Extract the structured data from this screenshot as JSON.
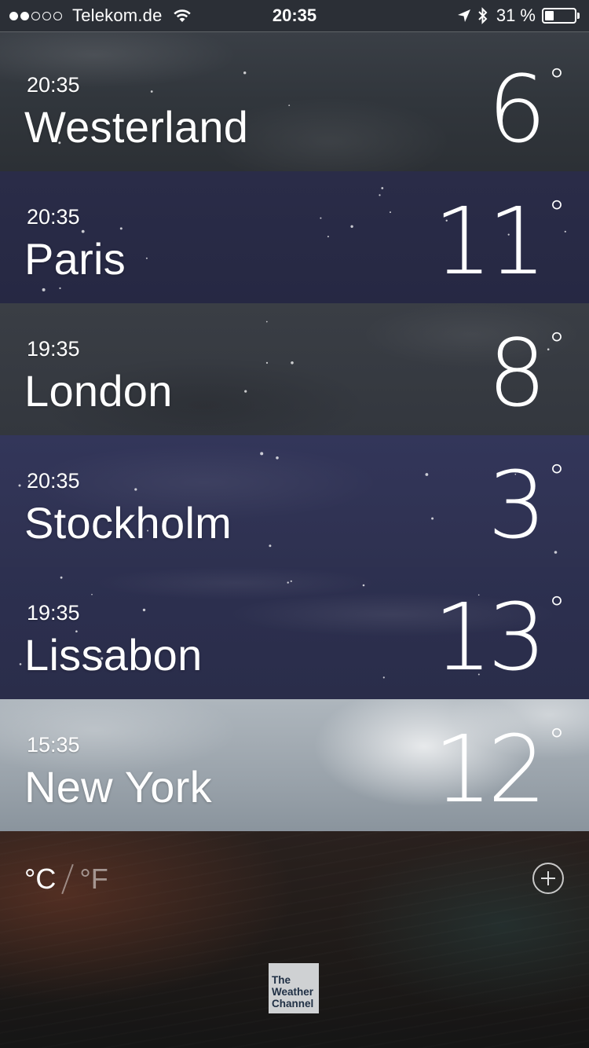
{
  "status_bar": {
    "signal_filled": 2,
    "signal_total": 5,
    "carrier": "Telekom.de",
    "time": "20:35",
    "battery_percent_label": "31 %",
    "battery_level": 0.31,
    "icons": [
      "wifi-icon",
      "location-arrow-icon",
      "bluetooth-icon",
      "battery-icon"
    ]
  },
  "cities": [
    {
      "time": "20:35",
      "name": "Westerland",
      "temp": "6",
      "degree": "°"
    },
    {
      "time": "20:35",
      "name": "Paris",
      "temp": "11",
      "degree": "°"
    },
    {
      "time": "19:35",
      "name": "London",
      "temp": "8",
      "degree": "°"
    },
    {
      "time": "20:35",
      "name": "Stockholm",
      "temp": "3",
      "degree": "°"
    },
    {
      "time": "19:35",
      "name": "Lissabon",
      "temp": "13",
      "degree": "°"
    },
    {
      "time": "15:35",
      "name": "New York",
      "temp": "12",
      "degree": "°"
    }
  ],
  "footer": {
    "unit_celsius": "°C",
    "unit_fahrenheit": "°F",
    "add_icon": "plus-circle-icon",
    "logo_lines": [
      "The",
      "Weather",
      "Channel"
    ]
  }
}
